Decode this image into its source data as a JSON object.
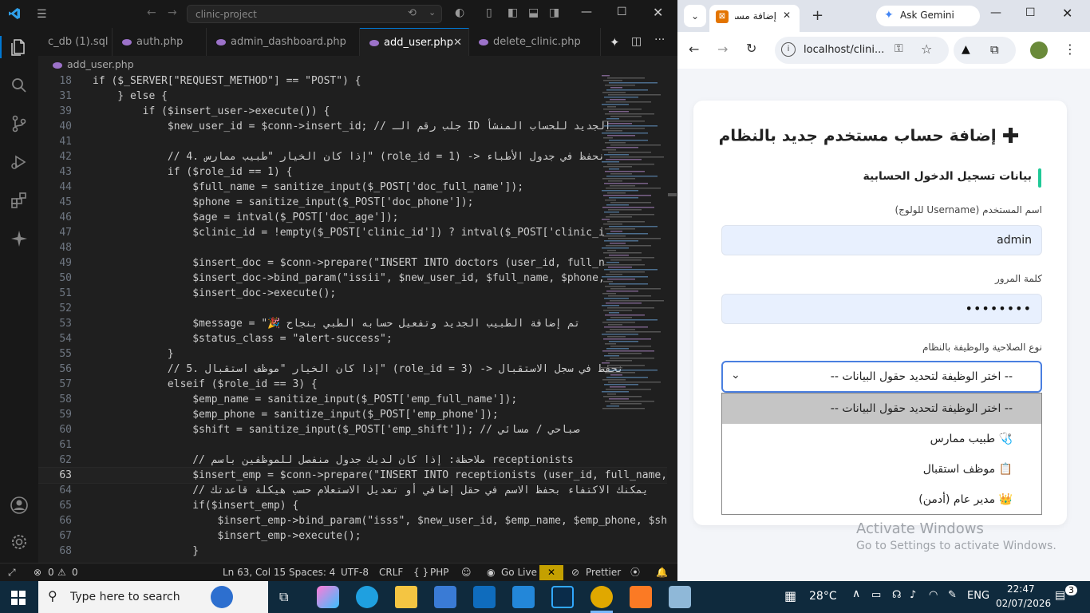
{
  "vscode": {
    "search_box": "clinic-project",
    "tabs": [
      {
        "label": "c_db (1).sql",
        "active": false
      },
      {
        "label": "auth.php",
        "active": false
      },
      {
        "label": "admin_dashboard.php",
        "active": false
      },
      {
        "label": "add_user.php",
        "active": true
      },
      {
        "label": "delete_clinic.php",
        "active": false
      }
    ],
    "breadcrumb": "add_user.php",
    "code_lines": [
      {
        "n": "18",
        "text": "if ($_SERVER[\"REQUEST_METHOD\"] == \"POST\") {"
      },
      {
        "n": "31",
        "text": "    } else {"
      },
      {
        "n": "39",
        "text": "        if ($insert_user->execute()) {"
      },
      {
        "n": "40",
        "text": "            $new_user_id = $conn->insert_id; // جلب رقم الـ ID الجديد للحساب المنشأ"
      },
      {
        "n": "41",
        "text": ""
      },
      {
        "n": "42",
        "text": "            // 4. إذا كان الخيار \"طبيب ممارس\" (role_id = 1) -> نحفظ في جدول الأطباء"
      },
      {
        "n": "43",
        "text": "            if ($role_id == 1) {"
      },
      {
        "n": "44",
        "text": "                $full_name = sanitize_input($_POST['doc_full_name']);"
      },
      {
        "n": "45",
        "text": "                $phone = sanitize_input($_POST['doc_phone']);"
      },
      {
        "n": "46",
        "text": "                $age = intval($_POST['doc_age']);"
      },
      {
        "n": "47",
        "text": "                $clinic_id = !empty($_POST['clinic_id']) ? intval($_POST['clinic_i"
      },
      {
        "n": "48",
        "text": ""
      },
      {
        "n": "49",
        "text": "                $insert_doc = $conn->prepare(\"INSERT INTO doctors (user_id, full_n"
      },
      {
        "n": "50",
        "text": "                $insert_doc->bind_param(\"issii\", $new_user_id, $full_name, $phone,"
      },
      {
        "n": "51",
        "text": "                $insert_doc->execute();"
      },
      {
        "n": "52",
        "text": ""
      },
      {
        "n": "53",
        "text": "                $message = \"🎉 تم إضافة الطبيب الجديد وتفعيل حسابه الطبي بنجاح"
      },
      {
        "n": "54",
        "text": "                $status_class = \"alert-success\";"
      },
      {
        "n": "55",
        "text": "            }"
      },
      {
        "n": "56",
        "text": "            // 5. إذا كان الخيار \"موظف استقبال\" (role_id = 3) -> نحفظ في سجل الاستقبال"
      },
      {
        "n": "57",
        "text": "            elseif ($role_id == 3) {"
      },
      {
        "n": "58",
        "text": "                $emp_name = sanitize_input($_POST['emp_full_name']);"
      },
      {
        "n": "59",
        "text": "                $emp_phone = sanitize_input($_POST['emp_phone']);"
      },
      {
        "n": "60",
        "text": "                $shift = sanitize_input($_POST['emp_shift']); // صباحي / مسائي"
      },
      {
        "n": "61",
        "text": ""
      },
      {
        "n": "62",
        "text": "                // ملاحظة: إذا كان لديك جدول منفصل للموظفين باسم receptionists"
      },
      {
        "n": "63",
        "text": "                $insert_emp = $conn->prepare(\"INSERT INTO receptionists (user_id, full_name, ph"
      },
      {
        "n": "64",
        "text": "                // يمكنك الاكتفاء بحفظ الاسم في حقل إضافي أو تعديل الاستعلام حسب هيكلة قاعدتك"
      },
      {
        "n": "65",
        "text": "                if($insert_emp) {"
      },
      {
        "n": "66",
        "text": "                    $insert_emp->bind_param(\"isss\", $new_user_id, $emp_name, $emp_phone, $shi"
      },
      {
        "n": "67",
        "text": "                    $insert_emp->execute();"
      },
      {
        "n": "68",
        "text": "                }"
      }
    ],
    "status": {
      "errors": "0",
      "warnings": "0",
      "position": "Ln 63, Col 15",
      "spaces": "Spaces: 4",
      "encoding": "UTF-8",
      "eol": "CRLF",
      "language": "PHP",
      "golive": "Go Live",
      "prettier": "Prettier"
    }
  },
  "browser": {
    "tab_title": "إضافة مست",
    "gemini_label": "Ask Gemini",
    "url": "localhost/clini...",
    "page": {
      "title": "إضافة حساب مستخدم جديد بالنظام",
      "section": "بيانات تسجيل الدخول الحسابية",
      "username_label": "اسم المستخدم (Username للولوج)",
      "username_value": "admin",
      "password_label": "كلمة المرور",
      "password_value": "••••••••",
      "role_label": "نوع الصلاحية والوظيفة بالنظام",
      "role_selected": "-- اختر الوظيفة لتحديد حقول البيانات --",
      "options": [
        "-- اختر الوظيفة لتحديد حقول البيانات --",
        "🩺 طبيب ممارس",
        "📋 موظف استقبال",
        "👑 مدير عام (أدمن)"
      ]
    },
    "watermark_title": "Activate Windows",
    "watermark_sub": "Go to Settings to activate Windows."
  },
  "taskbar": {
    "search_placeholder": "Type here to search",
    "temperature": "28°C",
    "language": "ENG",
    "time": "22:47",
    "date": "02/07/2026",
    "notifications": "3"
  }
}
